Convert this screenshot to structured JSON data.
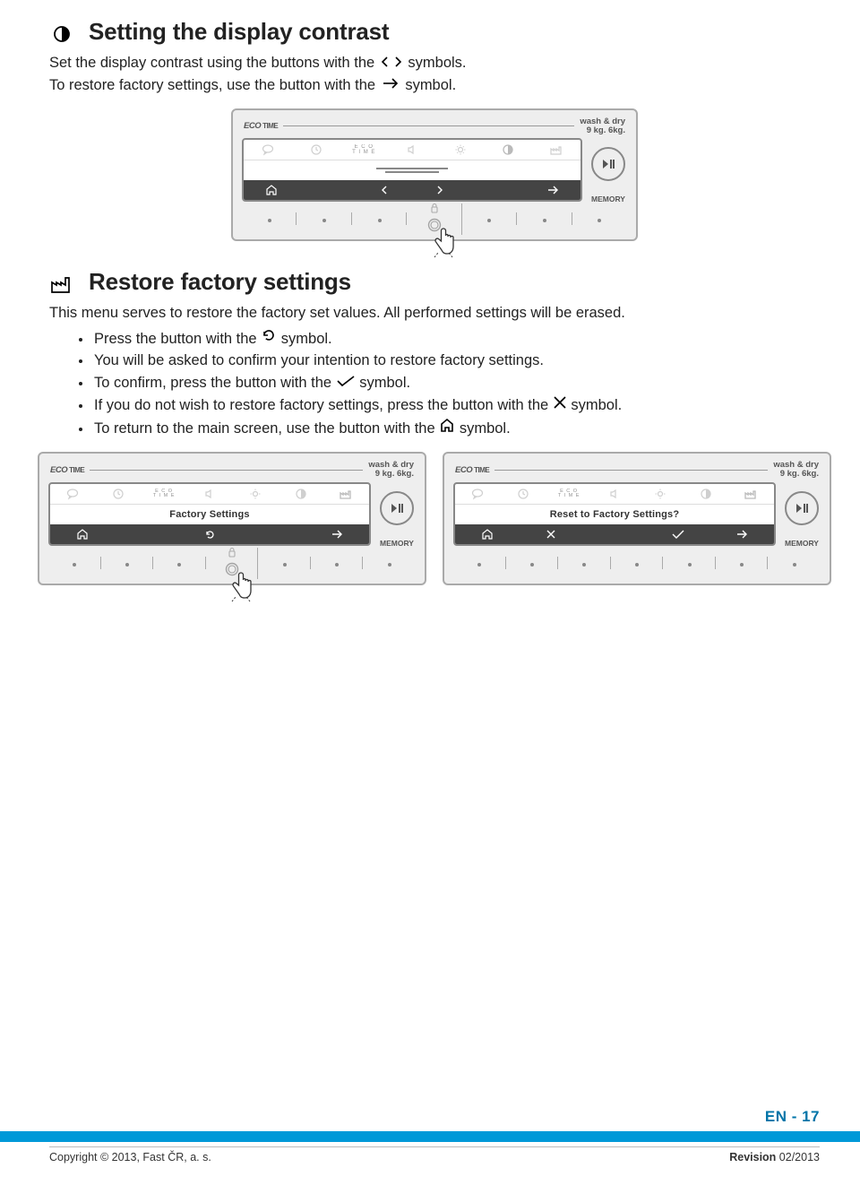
{
  "section1": {
    "title": "Setting the display contrast",
    "line1a": "Set the display contrast using the buttons with the",
    "line1b": "symbols.",
    "line2a": "To restore factory settings, use the button with the",
    "line2b": "symbol."
  },
  "section2": {
    "title": "Restore factory settings",
    "intro": "This menu serves to restore the factory set values. All performed settings will be erased.",
    "b1a": "Press the button with the",
    "b1b": "symbol.",
    "b2": "You will be asked to confirm your intention to restore factory settings.",
    "b3a": "To confirm, press the button with the",
    "b3b": "symbol.",
    "b4a": "If you do not wish to restore factory settings, press the button with the",
    "b4b": "symbol.",
    "b5a": "To return to the main screen, use the button with the",
    "b5b": "symbol."
  },
  "panel": {
    "brand": "ECO",
    "brandSub": "TIME",
    "washdry1": "wash & dry",
    "washdry2": "9 kg.    6kg.",
    "memory": "MEMORY",
    "ecoTimeSmall": "E C O\nT I M E",
    "screen_factory": "Factory Settings",
    "screen_reset": "Reset to Factory Settings?"
  },
  "footer": {
    "page": "EN - 17",
    "copyright": "Copyright © 2013, Fast ČR, a. s.",
    "revision_label": "Revision",
    "revision_value": " 02/2013"
  }
}
